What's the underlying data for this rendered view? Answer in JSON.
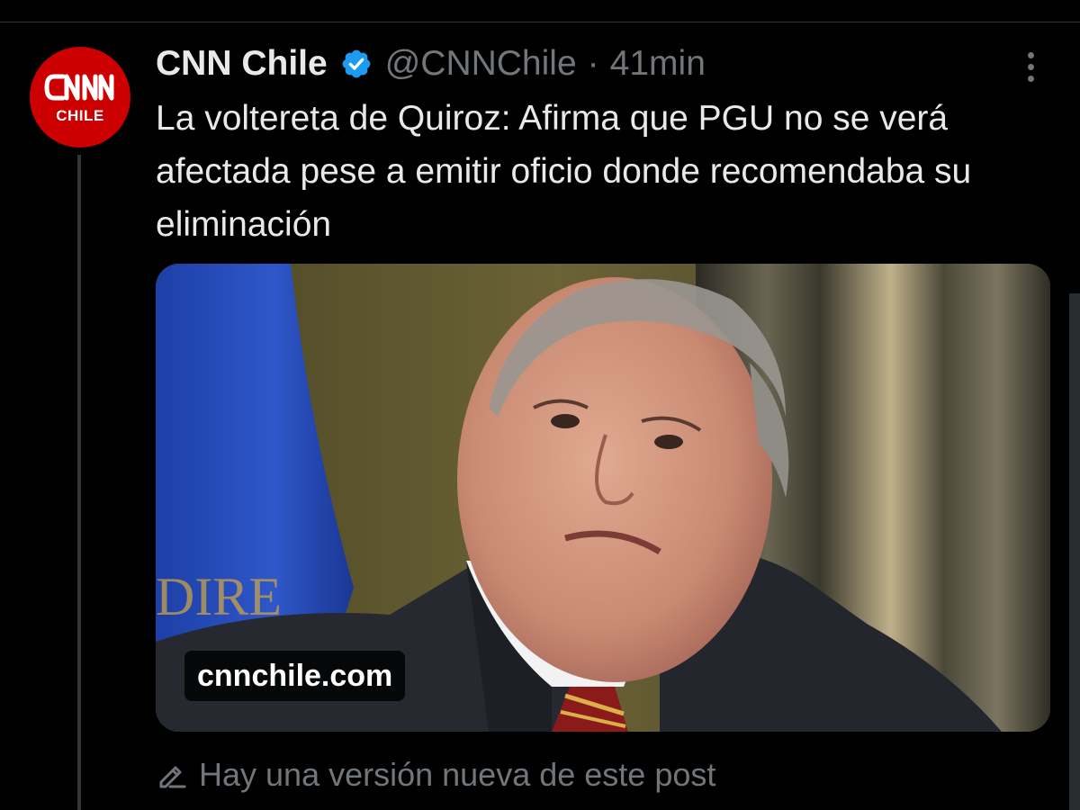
{
  "post": {
    "author": {
      "display_name": "CNN Chile",
      "handle": "@CNNChile",
      "verified": true,
      "avatar": {
        "logo_text": "CNN",
        "subtitle": "CHILE",
        "brand_color": "#cc0000"
      }
    },
    "separator": "·",
    "timestamp": "41min",
    "text": "La voltereta de Quiroz: Afirma que PGU no se verá afectada pese a emitir oficio donde recomendaba su eliminación",
    "media": {
      "domain": "cnnchile.com"
    },
    "edit_notice": "Hay una versión nueva de este post"
  },
  "icons": {
    "verified": "verified-badge-icon",
    "more": "more-options-icon",
    "edit": "edit-pencil-icon"
  },
  "colors": {
    "background": "#000000",
    "text_primary": "#e7e9ea",
    "text_secondary": "#71767b",
    "verified_blue": "#1d9bf0",
    "thread_line": "#333639"
  }
}
